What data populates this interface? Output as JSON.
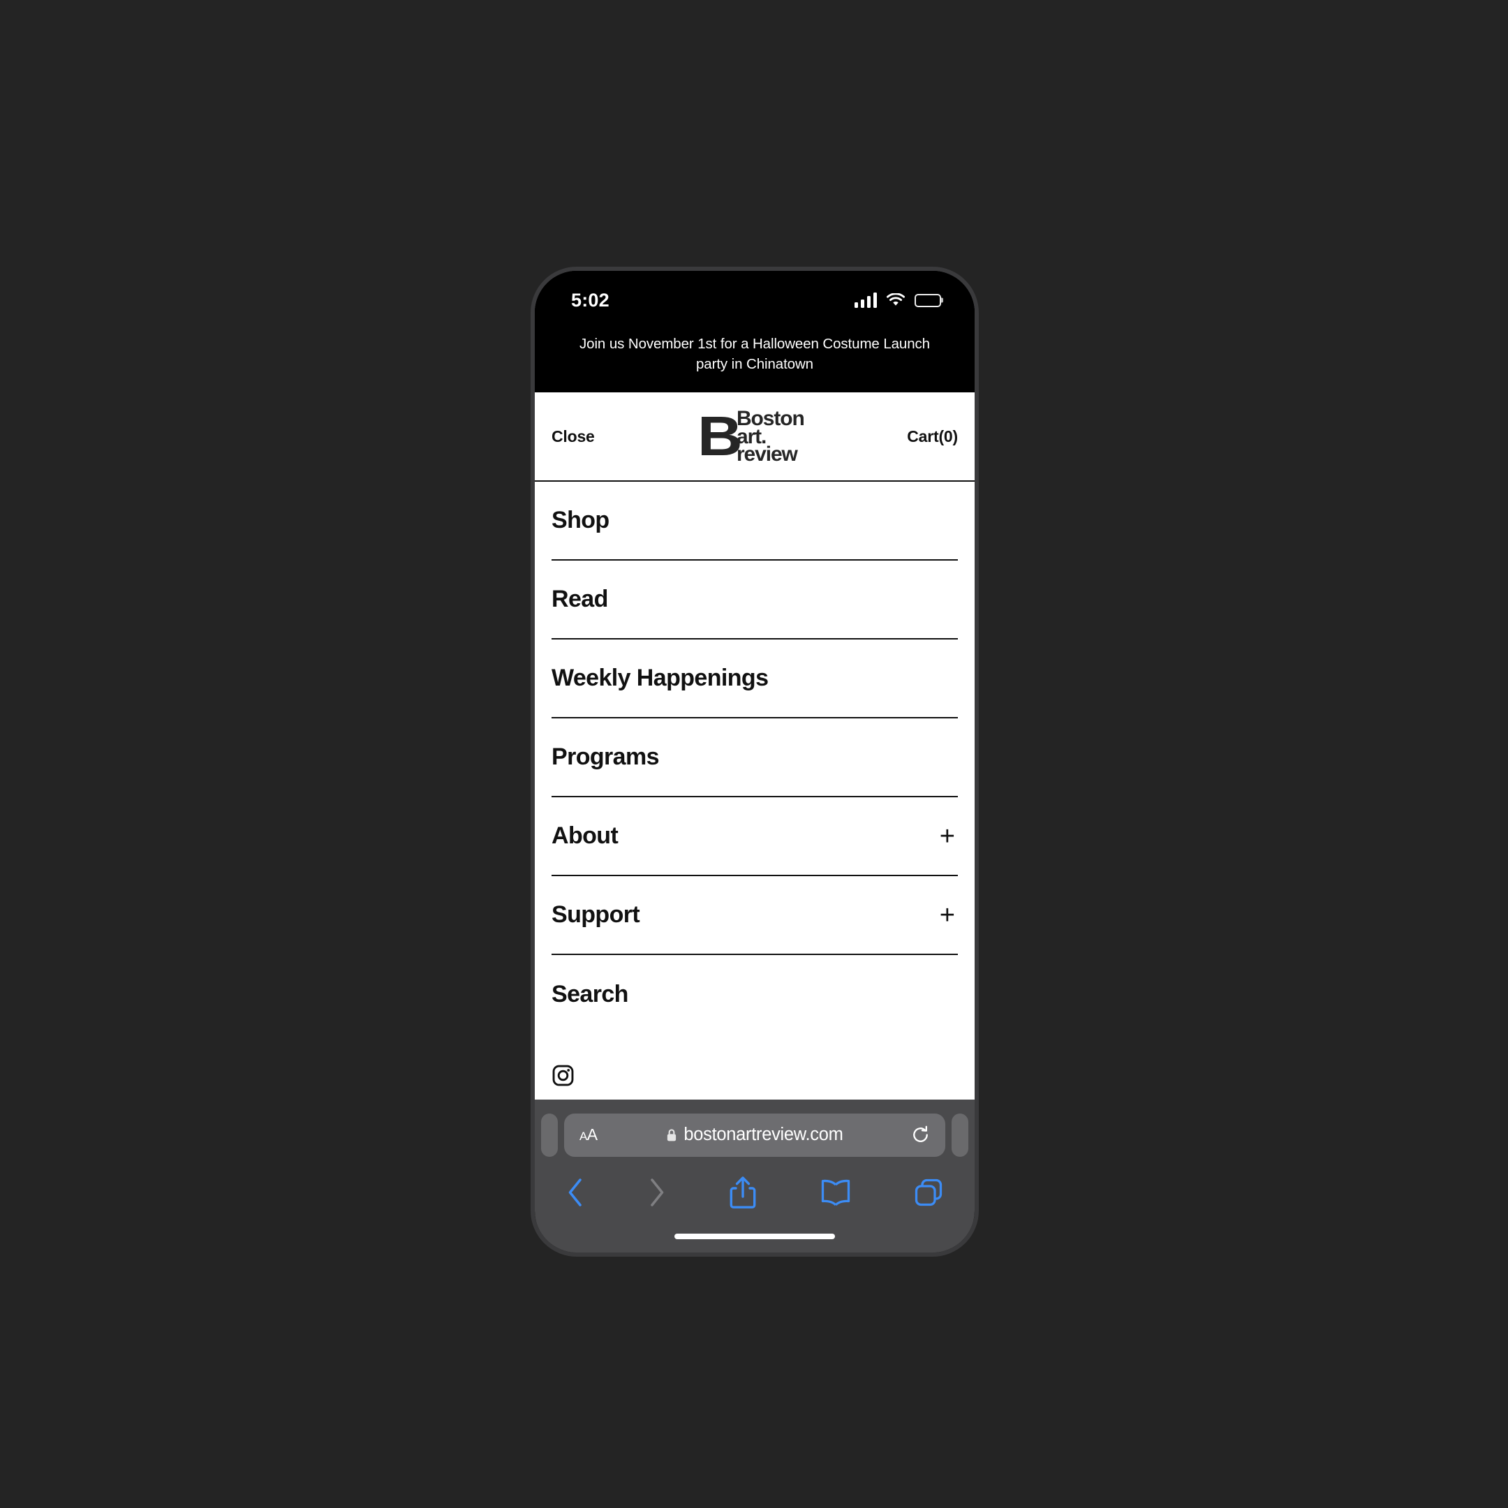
{
  "device": {
    "status_bar": {
      "time": "5:02",
      "signal_icon": "cellular-signal-icon",
      "wifi_icon": "wifi-icon",
      "battery_icon": "battery-low-icon",
      "battery_color": "#ffcc00"
    },
    "home_indicator": "home-indicator"
  },
  "announcement": {
    "text": "Join us November 1st for a Halloween Costume Launch party in Chinatown"
  },
  "site_header": {
    "close_label": "Close",
    "cart_label": "Cart(0)",
    "logo": {
      "mark": "B",
      "line1": "Boston",
      "line2": "art.",
      "line3": "review",
      "alt": "Boston Art Review"
    }
  },
  "nav": {
    "items": [
      {
        "label": "Shop",
        "expandable": false,
        "expand_icon": ""
      },
      {
        "label": "Read",
        "expandable": false,
        "expand_icon": ""
      },
      {
        "label": "Weekly Happenings",
        "expandable": false,
        "expand_icon": ""
      },
      {
        "label": "Programs",
        "expandable": false,
        "expand_icon": ""
      },
      {
        "label": "About",
        "expandable": true,
        "expand_icon": "+"
      },
      {
        "label": "Support",
        "expandable": true,
        "expand_icon": "+"
      },
      {
        "label": "Search",
        "expandable": false,
        "expand_icon": ""
      }
    ]
  },
  "social": {
    "instagram_icon": "instagram-icon"
  },
  "browser": {
    "text_size_label": "AA",
    "lock_icon": "lock-icon",
    "url": "bostonartreview.com",
    "reload_icon": "reload-icon",
    "accent_color": "#3c8cf5",
    "toolbar": {
      "back_icon": "chevron-left-icon",
      "forward_icon": "chevron-right-icon",
      "share_icon": "share-icon",
      "bookmarks_icon": "book-icon",
      "tabs_icon": "tabs-icon"
    }
  }
}
